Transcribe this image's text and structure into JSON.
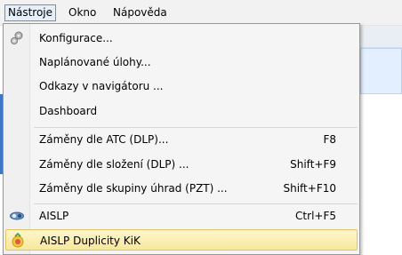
{
  "menubar": {
    "items": [
      {
        "label": "Nástroje"
      },
      {
        "label": "Okno"
      },
      {
        "label": "Nápověda"
      }
    ]
  },
  "menu": {
    "items": [
      {
        "label": "Konfigurace...",
        "shortcut": "",
        "icon": "gears-icon"
      },
      {
        "label": "Naplánované úlohy...",
        "shortcut": ""
      },
      {
        "label": "Odkazy v navigátoru ...",
        "shortcut": ""
      },
      {
        "label": "Dashboard",
        "shortcut": ""
      },
      {
        "label": "Záměny dle ATC (DLP)...",
        "shortcut": "F8"
      },
      {
        "label": "Záměny dle složení (DLP) ...",
        "shortcut": "Shift+F9"
      },
      {
        "label": "Záměny dle skupiny úhrad (PZT) ...",
        "shortcut": "Shift+F10"
      },
      {
        "label": "AISLP",
        "shortcut": "Ctrl+F5",
        "icon": "aislp-pill-icon"
      },
      {
        "label": "AISLP Duplicity KiK",
        "shortcut": "",
        "icon": "aislp-duplicity-icon"
      }
    ]
  },
  "colors": {
    "highlight_top": "#fdf6cf",
    "highlight_bottom": "#f8e89a",
    "highlight_border": "#e5c365",
    "menubar_bg": "#f2f2f2",
    "menu_bg": "#f5f5f5"
  }
}
